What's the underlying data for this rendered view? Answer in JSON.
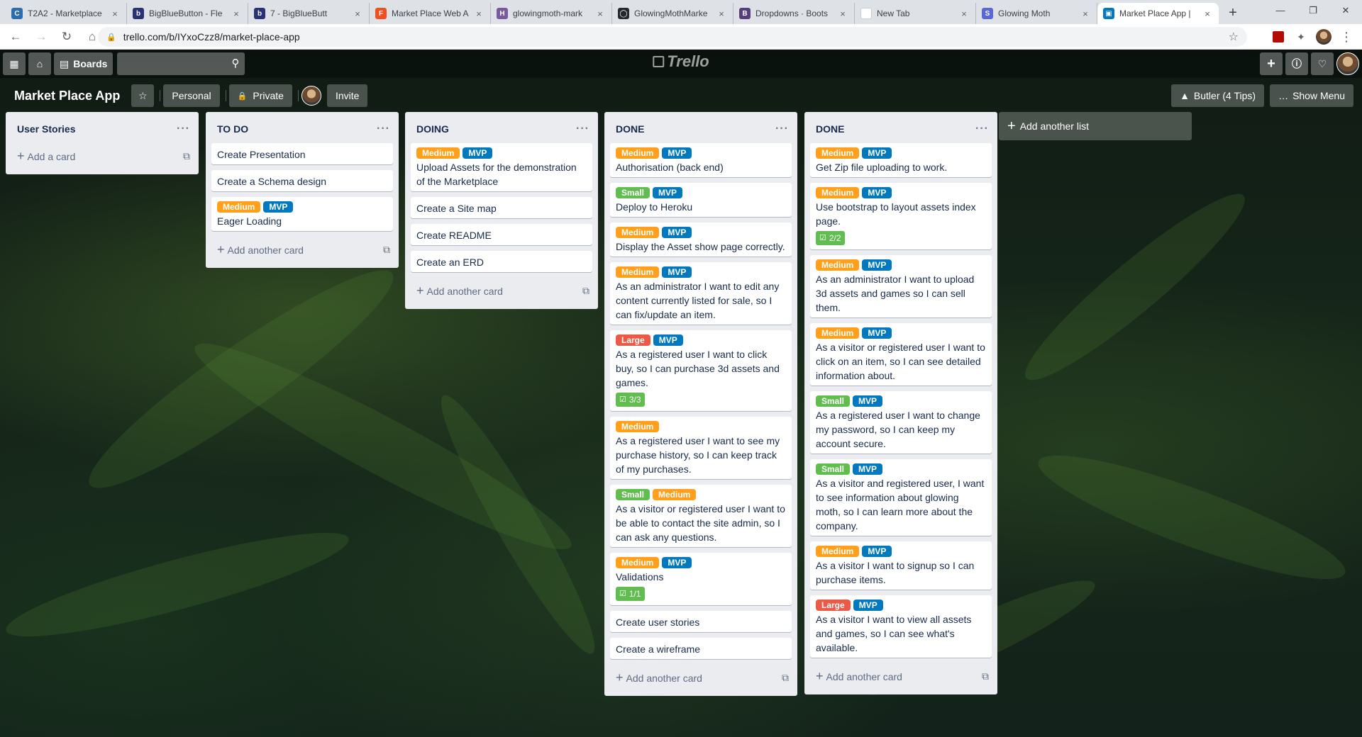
{
  "browser": {
    "tabs": [
      {
        "title": "T2A2 - Marketplace",
        "icon_color": "#2b6cb0",
        "icon_glyph": "C"
      },
      {
        "title": "BigBlueButton - Fle",
        "icon_color": "#283274",
        "icon_glyph": "b"
      },
      {
        "title": "7 - BigBlueButt",
        "icon_color": "#283274",
        "icon_glyph": "b"
      },
      {
        "title": "Market Place Web A",
        "icon_color": "#f24e1e",
        "icon_glyph": "F"
      },
      {
        "title": "glowingmoth-mark",
        "icon_color": "#79589f",
        "icon_glyph": "H"
      },
      {
        "title": "GlowingMothMarke",
        "icon_color": "#24292e",
        "icon_glyph": "◯"
      },
      {
        "title": "Dropdowns · Boots",
        "icon_color": "#563d7c",
        "icon_glyph": "B"
      },
      {
        "title": "New Tab",
        "icon_color": "#ffffff",
        "icon_glyph": ""
      },
      {
        "title": "Glowing Moth",
        "icon_color": "#5a67d8",
        "icon_glyph": "S"
      },
      {
        "title": "Market Place App |",
        "icon_color": "#0079bf",
        "icon_glyph": "▣"
      }
    ],
    "active_tab": 9,
    "url": "trello.com/b/IYxoCzz8/market-place-app"
  },
  "header": {
    "boards_label": "Boards",
    "logo_text": "Trello"
  },
  "board": {
    "title": "Market Place App",
    "visibility_personal": "Personal",
    "visibility_private": "Private",
    "invite_label": "Invite",
    "butler_label": "Butler (4 Tips)",
    "show_menu_label": "Show Menu",
    "add_list_label": "Add another list"
  },
  "lists": [
    {
      "title": "User Stories",
      "add_label": "Add a card",
      "cards": []
    },
    {
      "title": "TO DO",
      "add_label": "Add another card",
      "cards": [
        {
          "text": "Create Presentation",
          "labels": []
        },
        {
          "text": "Create a Schema design",
          "labels": []
        },
        {
          "text": "Eager Loading",
          "labels": [
            "Medium",
            "MVP"
          ]
        }
      ]
    },
    {
      "title": "DOING",
      "add_label": "Add another card",
      "cards": [
        {
          "text": "Upload Assets for the demonstration of the Marketplace",
          "labels": [
            "Medium",
            "MVP"
          ]
        },
        {
          "text": "Create a Site map",
          "labels": []
        },
        {
          "text": "Create README",
          "labels": []
        },
        {
          "text": "Create an ERD",
          "labels": []
        }
      ]
    },
    {
      "title": "DONE",
      "add_label": "Add another card",
      "cards": [
        {
          "text": "Authorisation (back end)",
          "labels": [
            "Medium",
            "MVP"
          ]
        },
        {
          "text": "Deploy to Heroku",
          "labels": [
            "Small",
            "MVP"
          ]
        },
        {
          "text": "Display the Asset show page correctly.",
          "labels": [
            "Medium",
            "MVP"
          ]
        },
        {
          "text": "As an administrator I want to edit any content currently listed for sale, so I can fix/update an item.",
          "labels": [
            "Medium",
            "MVP"
          ]
        },
        {
          "text": "As a registered user I want to click buy, so I can purchase 3d assets and games.",
          "labels": [
            "Large",
            "MVP"
          ],
          "checklist": "3/3"
        },
        {
          "text": "As a registered user I want to see my purchase history, so I can keep track of my purchases.",
          "labels": [
            "Medium"
          ]
        },
        {
          "text": "As a visitor or registered user I want to be able to contact the site admin, so I can ask any questions.",
          "labels": [
            "Small",
            "Medium"
          ]
        },
        {
          "text": "Validations",
          "labels": [
            "Medium",
            "MVP"
          ],
          "checklist": "1/1"
        },
        {
          "text": "Create user stories",
          "labels": []
        },
        {
          "text": "Create a wireframe",
          "labels": []
        }
      ]
    },
    {
      "title": "DONE",
      "add_label": "Add another card",
      "cards": [
        {
          "text": "Get Zip file uploading to work.",
          "labels": [
            "Medium",
            "MVP"
          ]
        },
        {
          "text": "Use bootstrap to layout assets index page.",
          "labels": [
            "Medium",
            "MVP"
          ],
          "checklist": "2/2"
        },
        {
          "text": "As an administrator I want to upload 3d assets and games so I can sell them.",
          "labels": [
            "Medium",
            "MVP"
          ]
        },
        {
          "text": "As a visitor or registered user I want to click on an item, so I can see detailed information about.",
          "labels": [
            "Medium",
            "MVP"
          ]
        },
        {
          "text": "As a registered user I want to change my password, so I can keep my account secure.",
          "labels": [
            "Small",
            "MVP"
          ]
        },
        {
          "text": "As a visitor and registered user, I want to see information about glowing moth, so I can learn more about the company.",
          "labels": [
            "Small",
            "MVP"
          ]
        },
        {
          "text": "As a visitor I want to signup so I can purchase items.",
          "labels": [
            "Medium",
            "MVP"
          ]
        },
        {
          "text": "As a visitor I want to view all assets and games, so I can see what's available.",
          "labels": [
            "Large",
            "MVP"
          ]
        }
      ]
    }
  ],
  "label_colors": {
    "Medium": "#ff9f1a",
    "MVP": "#0079bf",
    "Small": "#61bd4f",
    "Large": "#eb5a46"
  }
}
